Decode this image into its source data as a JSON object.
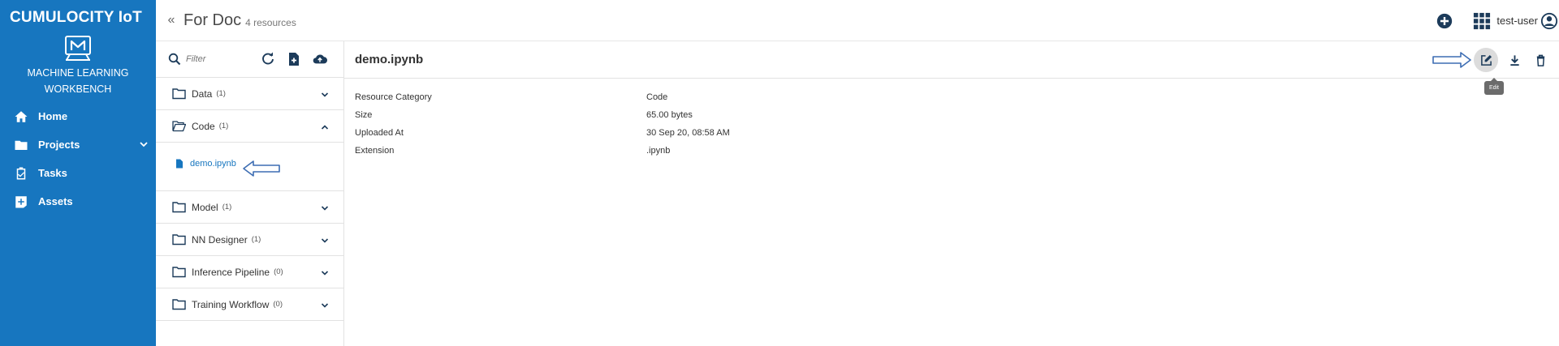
{
  "sidebar": {
    "brand": "CUMULOCITY IoT",
    "app_name": "MACHINE LEARNING WORKBENCH",
    "nav": [
      {
        "label": "Home",
        "icon": "home-icon"
      },
      {
        "label": "Projects",
        "icon": "folder-icon"
      },
      {
        "label": "Tasks",
        "icon": "clipboard-check-icon"
      },
      {
        "label": "Assets",
        "icon": "add-box-icon"
      }
    ]
  },
  "header": {
    "collapse_glyph": "«",
    "title": "For Doc",
    "subtitle": "4 resources",
    "user": "test-user"
  },
  "resources": {
    "filter_placeholder": "Filter",
    "folders": [
      {
        "name": "Data",
        "count": "(1)",
        "expanded": false
      },
      {
        "name": "Code",
        "count": "(1)",
        "expanded": true
      },
      {
        "name": "Model",
        "count": "(1)",
        "expanded": false
      },
      {
        "name": "NN Designer",
        "count": "(1)",
        "expanded": false
      },
      {
        "name": "Inference Pipeline",
        "count": "(0)",
        "expanded": false
      },
      {
        "name": "Training Workflow",
        "count": "(0)",
        "expanded": false
      }
    ],
    "file": "demo.ipynb"
  },
  "detail": {
    "title": "demo.ipynb",
    "tooltip": "Edit",
    "properties": [
      {
        "key": "Resource Category",
        "value": "Code"
      },
      {
        "key": "Size",
        "value": "65.00 bytes"
      },
      {
        "key": "Uploaded At",
        "value": "30 Sep 20, 08:58 AM"
      },
      {
        "key": "Extension",
        "value": ".ipynb"
      }
    ]
  },
  "colors": {
    "brand": "#1776bf",
    "header_icon": "#1c3b5a",
    "link": "#1776bf"
  }
}
